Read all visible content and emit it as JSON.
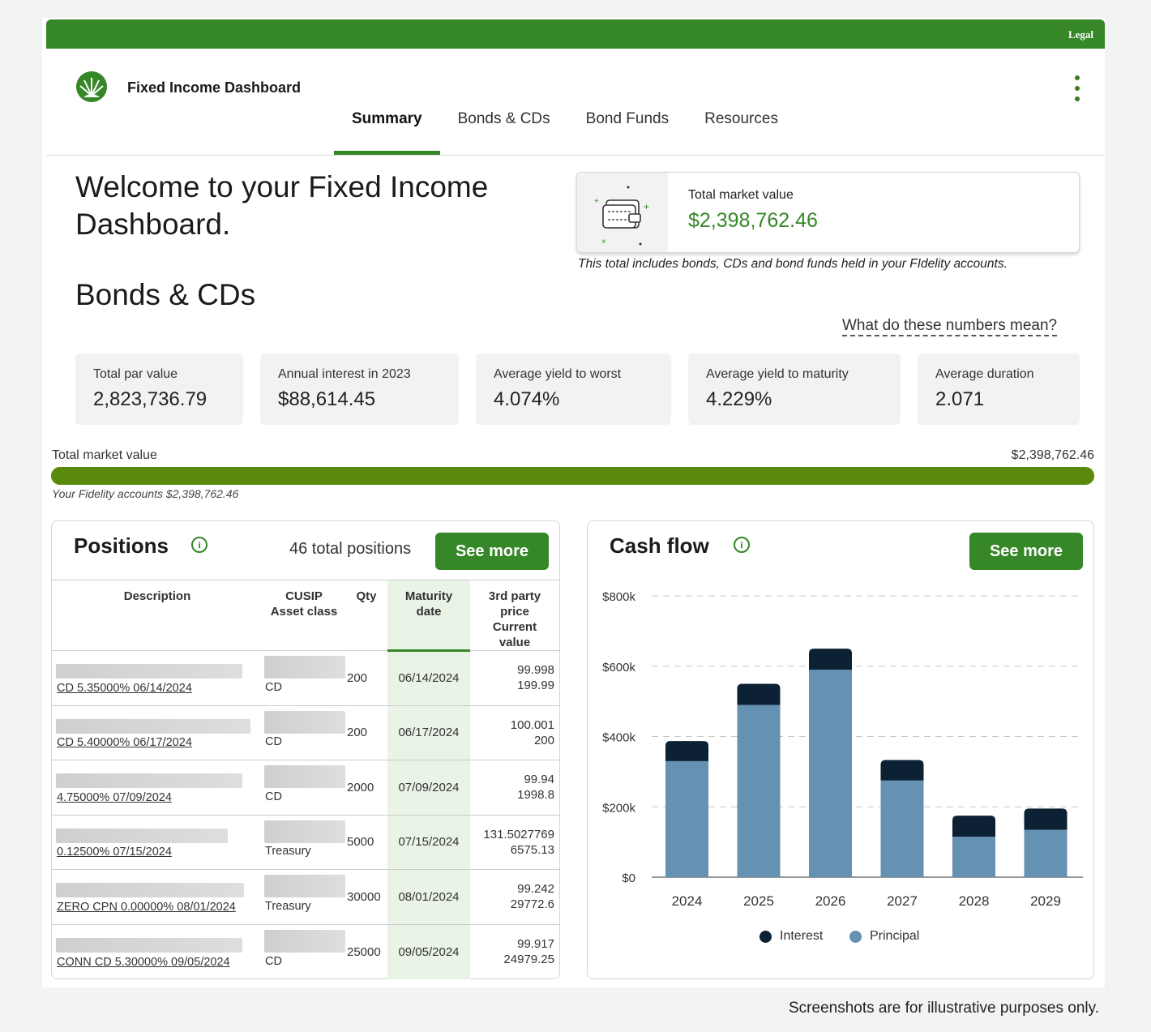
{
  "header": {
    "legal_label": "Legal",
    "app_title": "Fixed Income Dashboard",
    "tabs": [
      {
        "label": "Summary",
        "active": true
      },
      {
        "label": "Bonds & CDs",
        "active": false
      },
      {
        "label": "Bond Funds",
        "active": false
      },
      {
        "label": "Resources",
        "active": false
      }
    ]
  },
  "welcome": {
    "heading": "Welcome to your Fixed Income Dashboard.",
    "market_value_label": "Total market value",
    "market_value": "$2,398,762.46",
    "market_value_note": "This total includes bonds, CDs and bond funds held in your FIdelity accounts."
  },
  "bonds": {
    "heading": "Bonds & CDs",
    "help_link": "What do these numbers mean?",
    "stats": [
      {
        "label": "Total par value",
        "value": "2,823,736.79"
      },
      {
        "label": "Annual interest in 2023",
        "value": "$88,614.45"
      },
      {
        "label": "Average yield to worst",
        "value": "4.074%"
      },
      {
        "label": "Average yield to maturity",
        "value": "4.229%"
      },
      {
        "label": "Average duration",
        "value": "2.071"
      }
    ],
    "total_bar": {
      "label": "Total market value",
      "value": "$2,398,762.46",
      "fill_fraction": 1.0,
      "note": "Your Fidelity accounts $2,398,762.46"
    }
  },
  "positions": {
    "title": "Positions",
    "count": "46 total positions",
    "see_more": "See more",
    "columns": {
      "description": "Description",
      "cusip": "CUSIP",
      "asset_class": "Asset class",
      "qty": "Qty",
      "maturity_1": "Maturity",
      "maturity_2": "date",
      "price_1": "3rd party",
      "price_2": "price",
      "price_3": "Current",
      "price_4": "value"
    },
    "rows": [
      {
        "description": "CD 5.35000% 06/14/2024",
        "asset_class": "CD",
        "qty": "200",
        "maturity": "06/14/2024",
        "price": "99.998",
        "value": "199.99"
      },
      {
        "description": "CD 5.40000% 06/17/2024",
        "asset_class": "CD",
        "qty": "200",
        "maturity": "06/17/2024",
        "price": "100.001",
        "value": "200"
      },
      {
        "description": "4.75000% 07/09/2024",
        "asset_class": "CD",
        "qty": "2000",
        "maturity": "07/09/2024",
        "price": "99.94",
        "value": "1998.8"
      },
      {
        "description": "0.12500% 07/15/2024",
        "asset_class": "Treasury",
        "qty": "5000",
        "maturity": "07/15/2024",
        "price": "131.5027769",
        "value": "6575.13"
      },
      {
        "description": "ZERO CPN 0.00000% 08/01/2024",
        "asset_class": "Treasury",
        "qty": "30000",
        "maturity": "08/01/2024",
        "price": "99.242",
        "value": "29772.6"
      },
      {
        "description": "CONN CD 5.30000% 09/05/2024",
        "asset_class": "CD",
        "qty": "25000",
        "maturity": "09/05/2024",
        "price": "99.917",
        "value": "24979.25"
      }
    ]
  },
  "cashflow": {
    "title": "Cash flow",
    "see_more": "See more",
    "legend_interest": "Interest",
    "legend_principal": "Principal",
    "colors": {
      "interest": "#0c2133",
      "principal": "#6591b3"
    }
  },
  "chart_data": {
    "type": "bar",
    "stacked": true,
    "categories": [
      "2024",
      "2025",
      "2026",
      "2027",
      "2028",
      "2029"
    ],
    "series": [
      {
        "name": "Principal",
        "values": [
          330000,
          490000,
          590000,
          275000,
          115000,
          135000
        ]
      },
      {
        "name": "Interest",
        "values": [
          57000,
          60000,
          60000,
          58000,
          60000,
          60000
        ]
      }
    ],
    "y_ticks": [
      "$0",
      "$200k",
      "$400k",
      "$600k",
      "$800k"
    ],
    "ylim": [
      0,
      800000
    ],
    "legend_position": "bottom",
    "grid": true
  },
  "footer": {
    "disclaimer": "Screenshots are for illustrative purposes only."
  }
}
